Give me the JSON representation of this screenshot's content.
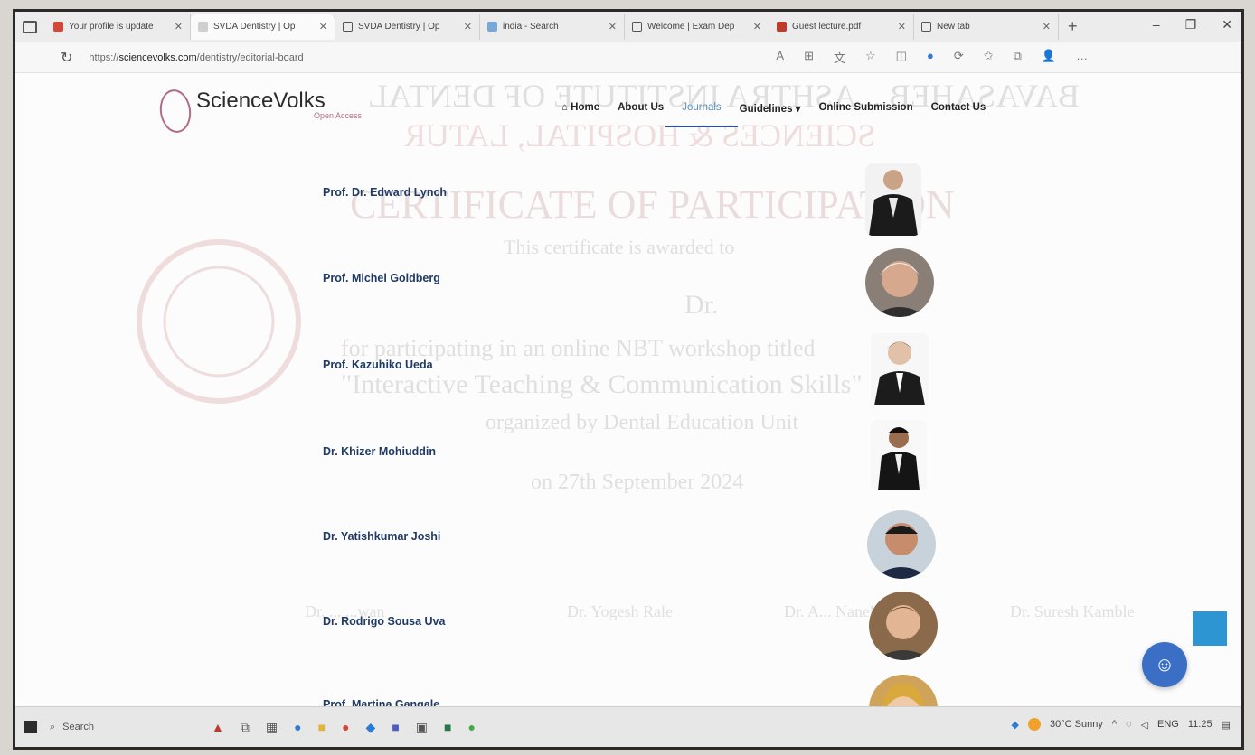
{
  "browser": {
    "tabs": [
      {
        "label": "Your profile is update",
        "favicon_color": "#d44638",
        "active": false
      },
      {
        "label": "SVDA Dentistry | Op",
        "favicon_color": "#cfcfcf",
        "active": true
      },
      {
        "label": "SVDA Dentistry | Op",
        "favicon_color": "#555555",
        "active": false
      },
      {
        "label": "india - Search",
        "favicon_color": "#7aa7d8",
        "active": false
      },
      {
        "label": "Welcome | Exam Dep",
        "favicon_color": "#555555",
        "active": false
      },
      {
        "label": "Guest lecture.pdf",
        "favicon_color": "#c0392b",
        "active": false
      },
      {
        "label": "New tab",
        "favicon_color": "#555555",
        "active": false
      }
    ],
    "url_prefix": "https://",
    "url_domain": "sciencevolks.com",
    "url_path": "/dentistry/editorial-board"
  },
  "site": {
    "logo_text": "ScienceVolks",
    "logo_sub": "Open Access",
    "nav": [
      {
        "label": "⌂ Home"
      },
      {
        "label": "About Us"
      },
      {
        "label": "Journals",
        "active": true
      },
      {
        "label": "Guidelines ▾"
      },
      {
        "label": "Online Submission"
      },
      {
        "label": "Contact Us"
      }
    ],
    "members": [
      {
        "name": "Prof. Dr. Edward Lynch"
      },
      {
        "name": "Prof. Michel Goldberg"
      },
      {
        "name": "Prof. Kazuhiko Ueda"
      },
      {
        "name": "Dr. Khizer Mohiuddin"
      },
      {
        "name": "Dr. Yatishkumar Joshi"
      },
      {
        "name": "Dr. Rodrigo Sousa Uva"
      },
      {
        "name": "Prof. Martina Gangale"
      }
    ]
  },
  "watermark": {
    "line1": "BAVASAHEB ...ASHTRA INSTITUTE OF DENTAL",
    "line2": "SCIENCES & HOSPITAL, LATUR",
    "line3": "CERTIFICATE OF PARTICIPATION",
    "line4": "This certificate is awarded to",
    "line5": "Dr.",
    "line6": "for participating in an online NBT workshop titled",
    "line7": "\"Interactive Teaching & Communication Skills\"",
    "line8": "organized by Dental Education Unit",
    "line9": "on 27th September 2024",
    "sig1": "Dr. Suresh Kamble",
    "sig2": "Dr. Yogesh Rale",
    "sig3": "Dr. A... Nanekar",
    "sig4": "Dr. ... ...wan"
  },
  "taskbar": {
    "search": "Search",
    "weather": "30°C Sunny",
    "lang": "ENG",
    "time": "11:25"
  }
}
